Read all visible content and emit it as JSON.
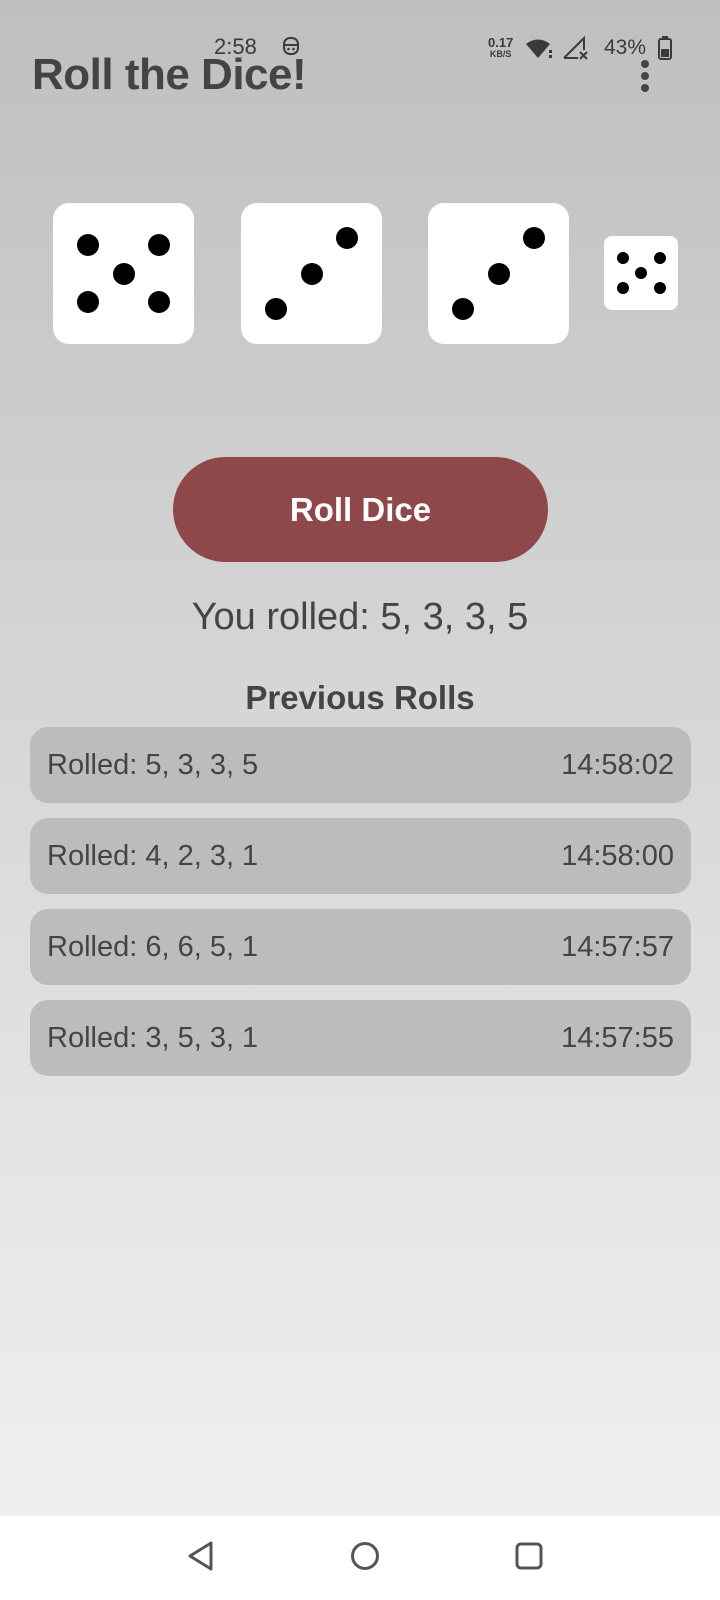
{
  "status_bar": {
    "time": "2:58",
    "net_speed_value": "0.17",
    "net_speed_unit": "KB/S",
    "battery": "43%",
    "icons": [
      "notification-icon",
      "wifi-icon",
      "signal-icon",
      "battery-icon"
    ]
  },
  "app": {
    "title": "Roll the Dice!",
    "menu_icon": "more-vert-icon"
  },
  "dice": [
    5,
    3,
    3,
    5
  ],
  "roll_button_label": "Roll Dice",
  "result_text": "You rolled: 5, 3, 3, 5",
  "history_heading": "Previous Rolls",
  "history": [
    {
      "roll": "Rolled: 5, 3, 3, 5",
      "time": "14:58:02"
    },
    {
      "roll": "Rolled: 4, 2, 3, 1",
      "time": "14:58:00"
    },
    {
      "roll": "Rolled: 6, 6, 5, 1",
      "time": "14:57:57"
    },
    {
      "roll": "Rolled: 3, 5, 3, 1",
      "time": "14:57:55"
    }
  ],
  "nav": {
    "icons": [
      "back-icon",
      "home-icon",
      "recents-icon"
    ]
  },
  "colors": {
    "accent": "#8f484a",
    "row_background": "#bcbcbc",
    "text": "#444444",
    "die_face": "#ffffff",
    "pip": "#000000"
  }
}
